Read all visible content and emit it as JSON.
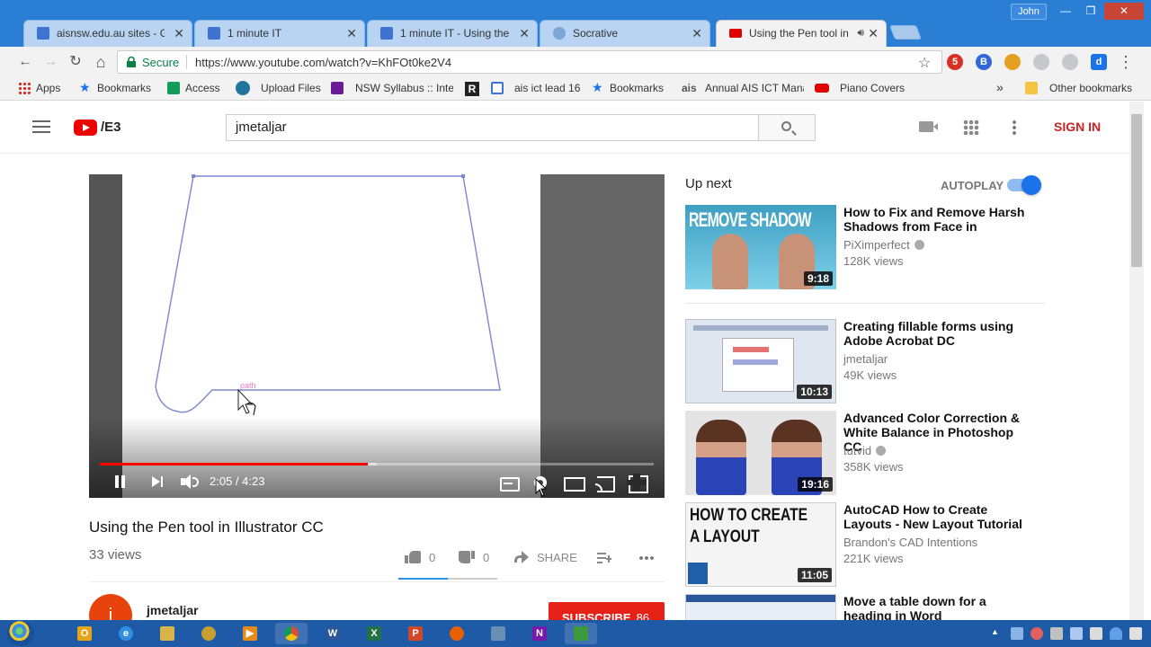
{
  "window": {
    "user_label": "John",
    "minimize_glyph": "—",
    "maximize_glyph": "❐",
    "close_glyph": "✕"
  },
  "tabs": [
    {
      "title": "aisnsw.edu.au sites - Goo",
      "icon": "google-sites-icon",
      "color": "#3f73d1"
    },
    {
      "title": "1 minute IT",
      "icon": "blogger-doc-icon",
      "color": "#3f73d1"
    },
    {
      "title": "1 minute IT - Using the T",
      "icon": "blogger-doc-icon",
      "color": "#3f73d1"
    },
    {
      "title": "Socrative",
      "icon": "socrative-icon",
      "color": "#7aa6d8"
    },
    {
      "title": "Using the Pen tool in",
      "icon": "youtube-icon",
      "color": "#e00000",
      "active": true
    }
  ],
  "tab_close_glyph": "✕",
  "toolbar": {
    "back_glyph": "←",
    "forward_glyph": "→",
    "reload_glyph": "↻",
    "home_glyph": "⌂",
    "secure_label": "Secure",
    "url": "https://www.youtube.com/watch?v=KhFOt0ke2V4",
    "star_glyph": "☆",
    "menu_glyph": "⋮"
  },
  "extensions": [
    {
      "label": "5",
      "color": "#d93025"
    },
    {
      "label": "B",
      "color": "#3367d6"
    },
    {
      "label": "",
      "color": "#e5a021"
    },
    {
      "label": "",
      "color": "#9aa0a6"
    },
    {
      "label": "",
      "color": "#9aa0a6"
    },
    {
      "label": "d",
      "color": "#1a73e8"
    }
  ],
  "bookmarks": [
    {
      "label": "Apps",
      "icon": "apps-grid-icon",
      "color": "#d93025"
    },
    {
      "label": "Bookmarks",
      "icon": "star-icon",
      "color": "#1a73e8"
    },
    {
      "label": "Access",
      "icon": "sheet-icon",
      "color": "#0f9d58"
    },
    {
      "label": "Upload Files",
      "icon": "wordpress-icon",
      "color": "#21759b"
    },
    {
      "label": "NSW Syllabus :: Inte",
      "icon": "syllabus-icon",
      "color": "#6a1b9a"
    },
    {
      "label": "",
      "icon": "r-icon",
      "color": "#222222"
    },
    {
      "label": "ais ict lead 16",
      "icon": "doc-icon",
      "color": "#3f73d1"
    },
    {
      "label": "Bookmarks",
      "icon": "star-icon",
      "color": "#1a73e8"
    },
    {
      "label": "Annual AIS ICT Mana",
      "icon": "ais-icon",
      "color": "#555555"
    },
    {
      "label": "Piano Covers",
      "icon": "youtube-icon",
      "color": "#e00000"
    }
  ],
  "bookmarks_overflow": "»",
  "other_bookmarks": "Other bookmarks",
  "youtube": {
    "logo_text": "/E3",
    "search_value": "jmetaljar",
    "sign_in": "SIGN IN"
  },
  "player": {
    "progress_fraction": 0.484,
    "buffer_fraction": 0.5,
    "time": "2:05 / 4:23",
    "path_label": "path"
  },
  "video": {
    "title": "Using the Pen tool in Illustrator CC",
    "views": "33 views",
    "likes": "0",
    "dislikes": "0",
    "share": "SHARE",
    "channel": "jmetaljar",
    "channel_initial": "j",
    "subscribe": "SUBSCRIBE",
    "subscriber_count": "86"
  },
  "sidebar": {
    "up_next": "Up next",
    "autoplay": "AUTOPLAY",
    "autoplay_on": true,
    "videos": [
      {
        "title": "How to Fix and Remove Harsh Shadows from Face in",
        "channel": "PiXimperfect",
        "verified": true,
        "views": "128K views",
        "duration": "9:18",
        "thumb_text": "REMOVE SHADOW",
        "thumb_color": "#4aa8c8"
      },
      {
        "title": "Creating fillable forms using Adobe Acrobat DC",
        "channel": "jmetaljar",
        "verified": false,
        "views": "49K views",
        "duration": "10:13",
        "thumb_text": "",
        "thumb_color": "#dfe6f0"
      },
      {
        "title": "Advanced Color Correction & White Balance in Photoshop CC",
        "channel": "tutvid",
        "verified": true,
        "views": "358K views",
        "duration": "19:16",
        "thumb_text": "",
        "thumb_color": "#d9d9d9"
      },
      {
        "title": "AutoCAD How to Create Layouts - New Layout Tutorial",
        "channel": "Brandon's CAD Intentions",
        "verified": false,
        "views": "221K views",
        "duration": "11:05",
        "thumb_text": "HOW TO CREATE A LAYOUT",
        "thumb_color": "#f4f4f4"
      },
      {
        "title": "Move a table down for a heading in Word",
        "channel": "",
        "verified": false,
        "views": "",
        "duration": "",
        "thumb_text": "",
        "thumb_color": "#e9eef6"
      }
    ]
  },
  "taskbar": {
    "apps": [
      {
        "icon": "outlook-icon",
        "glyph": "O",
        "color": "#e8a318"
      },
      {
        "icon": "internet-explorer-icon",
        "glyph": "e",
        "color": "#2f8fe0"
      },
      {
        "icon": "file-explorer-icon",
        "glyph": "",
        "color": "#d9b44a"
      },
      {
        "icon": "program-icon",
        "glyph": "",
        "color": "#c8a030"
      },
      {
        "icon": "media-player-icon",
        "glyph": "▶",
        "color": "#e88a1a"
      },
      {
        "icon": "chrome-icon",
        "glyph": "",
        "color": "#dd4b39"
      },
      {
        "icon": "word-icon",
        "glyph": "W",
        "color": "#2b579a"
      },
      {
        "icon": "excel-icon",
        "glyph": "X",
        "color": "#217346"
      },
      {
        "icon": "powerpoint-icon",
        "glyph": "P",
        "color": "#d24726"
      },
      {
        "icon": "firefox-icon",
        "glyph": "",
        "color": "#e66000"
      },
      {
        "icon": "calculator-icon",
        "glyph": "",
        "color": "#6a8fb4"
      },
      {
        "icon": "onenote-icon",
        "glyph": "N",
        "color": "#7719aa"
      },
      {
        "icon": "camtasia-icon",
        "glyph": "",
        "color": "#3c9a3c"
      }
    ],
    "tray_up_glyph": "▲"
  }
}
